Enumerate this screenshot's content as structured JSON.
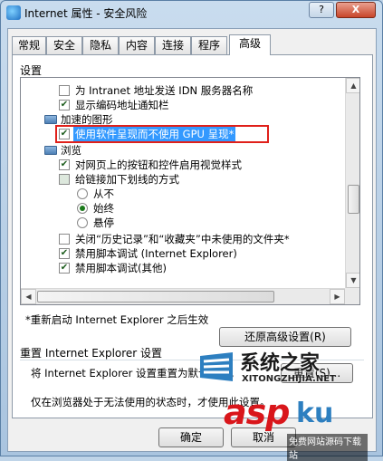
{
  "window": {
    "title": "Internet 属性 - 安全风险",
    "help_label": "?",
    "close_label": "X"
  },
  "tabs": [
    {
      "label": "常规"
    },
    {
      "label": "安全"
    },
    {
      "label": "隐私"
    },
    {
      "label": "内容"
    },
    {
      "label": "连接"
    },
    {
      "label": "程序"
    },
    {
      "label": "高级",
      "active": true
    }
  ],
  "settings": {
    "heading": "设置",
    "items": [
      {
        "kind": "checkbox",
        "label": "为 Intranet 地址发送 IDN 服务器名称",
        "checked": false
      },
      {
        "kind": "checkbox",
        "label": "显示编码地址通知栏",
        "checked": true
      },
      {
        "kind": "folder",
        "label": "加速的图形"
      },
      {
        "kind": "checkbox",
        "label": "使用软件呈现而不使用 GPU 呈现*",
        "checked": true,
        "selected": true
      },
      {
        "kind": "folder",
        "label": "浏览"
      },
      {
        "kind": "checkbox",
        "label": "对网页上的按钮和控件启用视觉样式",
        "checked": true
      },
      {
        "kind": "checkbox",
        "label": "给链接加下划线的方式",
        "checked": false,
        "partial": true
      },
      {
        "kind": "radio",
        "label": "从不",
        "checked": false
      },
      {
        "kind": "radio",
        "label": "始终",
        "checked": true
      },
      {
        "kind": "radio",
        "label": "悬停",
        "checked": false
      },
      {
        "kind": "checkbox",
        "label": "关闭“历史记录”和“收藏夹”中未使用的文件夹*",
        "checked": false
      },
      {
        "kind": "checkbox",
        "label": "禁用脚本调试 (Internet Explorer)",
        "checked": true
      },
      {
        "kind": "checkbox",
        "label": "禁用脚本调试(其他)",
        "checked": true
      }
    ]
  },
  "restart_note": "*重新启动 Internet Explorer 之后生效",
  "restore_button": "还原高级设置(R)",
  "reset": {
    "heading": "重置 Internet Explorer 设置",
    "description": "将 Internet Explorer 设置重置为默认设置。",
    "button": "重置(S)...",
    "warning": "仅在浏览器处于无法使用的状态时，才使用此设置。"
  },
  "footer": {
    "ok": "确定",
    "cancel": "取消"
  },
  "watermark": {
    "site_name": "系统之家",
    "site_url": "XITONGZHIJIA.NET",
    "brand_red": "asp",
    "brand_blue": "ku",
    "brand_sub": "免费网站源码下载站"
  },
  "colors": {
    "highlight": "#e0201a",
    "selection": "#3399ff"
  }
}
